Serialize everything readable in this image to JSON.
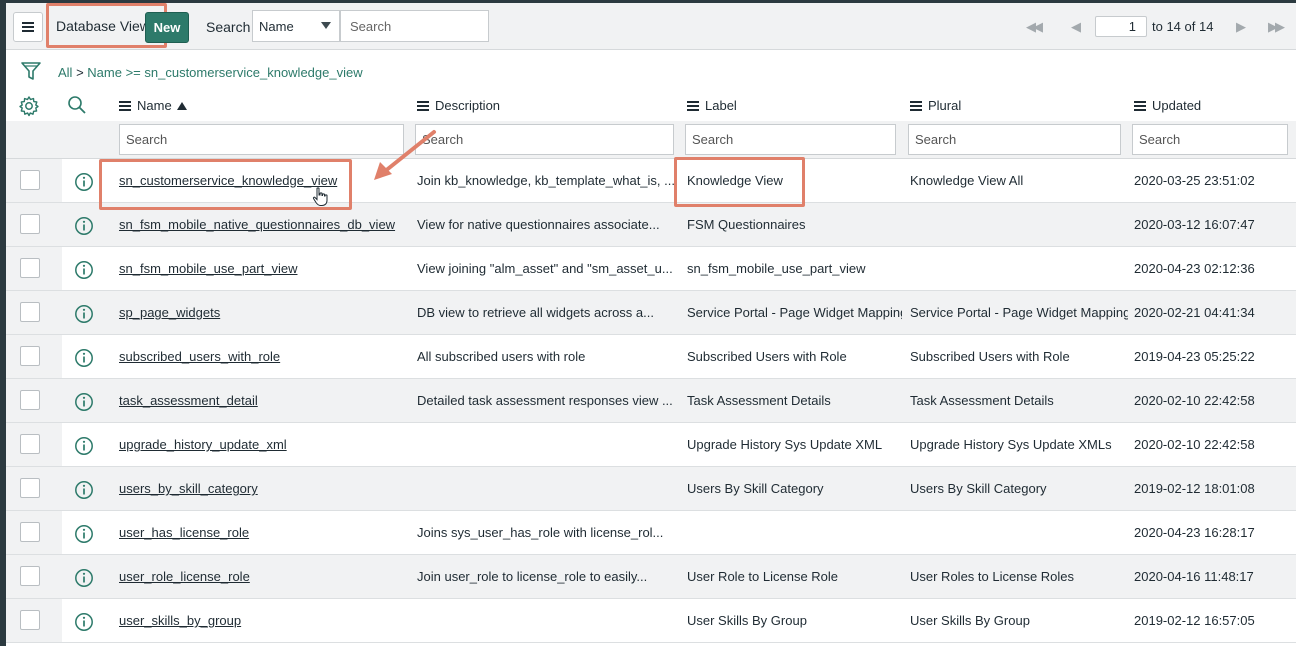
{
  "header": {
    "title": "Database Views",
    "new_label": "New",
    "search_label": "Search",
    "field_select": "Name",
    "search_placeholder": "Search",
    "pager": {
      "current_page": "1",
      "range_text": "to 14 of 14"
    }
  },
  "breadcrumb": {
    "all": "All",
    "separator": ">",
    "filter": "Name >= sn_customerservice_knowledge_view"
  },
  "columns": [
    {
      "label": "Name",
      "sorted": "ascending"
    },
    {
      "label": "Description"
    },
    {
      "label": "Label"
    },
    {
      "label": "Plural"
    },
    {
      "label": "Updated"
    }
  ],
  "column_search_placeholder": "Search",
  "rows": [
    {
      "name": "sn_customerservice_knowledge_view",
      "description": "Join kb_knowledge, kb_template_what_is, ...",
      "label": "Knowledge View",
      "plural": "Knowledge View All",
      "updated": "2020-03-25 23:51:02"
    },
    {
      "name": "sn_fsm_mobile_native_questionnaires_db_view",
      "description": "View for native questionnaires associate...",
      "label": "FSM Questionnaires",
      "plural": "",
      "updated": "2020-03-12 16:07:47"
    },
    {
      "name": "sn_fsm_mobile_use_part_view",
      "description": "View joining \"alm_asset\" and \"sm_asset_u...",
      "label": "sn_fsm_mobile_use_part_view",
      "plural": "",
      "updated": "2020-04-23 02:12:36"
    },
    {
      "name": "sp_page_widgets",
      "description": "DB view to retrieve all widgets across a...",
      "label": "Service Portal - Page Widget Mapping",
      "plural": "Service Portal - Page Widget Mapping",
      "updated": "2020-02-21 04:41:34"
    },
    {
      "name": "subscribed_users_with_role",
      "description": "All subscribed users with role",
      "label": "Subscribed Users with Role",
      "plural": "Subscribed Users with Role",
      "updated": "2019-04-23 05:25:22"
    },
    {
      "name": "task_assessment_detail",
      "description": "Detailed task assessment responses view ...",
      "label": "Task Assessment Details",
      "plural": "Task Assessment Details",
      "updated": "2020-02-10 22:42:58"
    },
    {
      "name": "upgrade_history_update_xml",
      "description": "",
      "label": "Upgrade History Sys Update XML",
      "plural": "Upgrade History Sys Update XMLs",
      "updated": "2020-02-10 22:42:58"
    },
    {
      "name": "users_by_skill_category",
      "description": "",
      "label": "Users By Skill Category",
      "plural": "Users By Skill Category",
      "updated": "2019-02-12 18:01:08"
    },
    {
      "name": "user_has_license_role",
      "description": "Joins sys_user_has_role with license_rol...",
      "label": "",
      "plural": "",
      "updated": "2020-04-23 16:28:17"
    },
    {
      "name": "user_role_license_role",
      "description": "Join user_role to license_role to easily...",
      "label": "User Role to License Role",
      "plural": "User Roles to License Roles",
      "updated": "2020-04-16 11:48:17"
    },
    {
      "name": "user_skills_by_group",
      "description": "",
      "label": "User Skills By Group",
      "plural": "User Skills By Group",
      "updated": "2019-02-12 16:57:05"
    }
  ],
  "colors": {
    "accent": "#2d7a6a",
    "highlight": "#e0806a"
  }
}
